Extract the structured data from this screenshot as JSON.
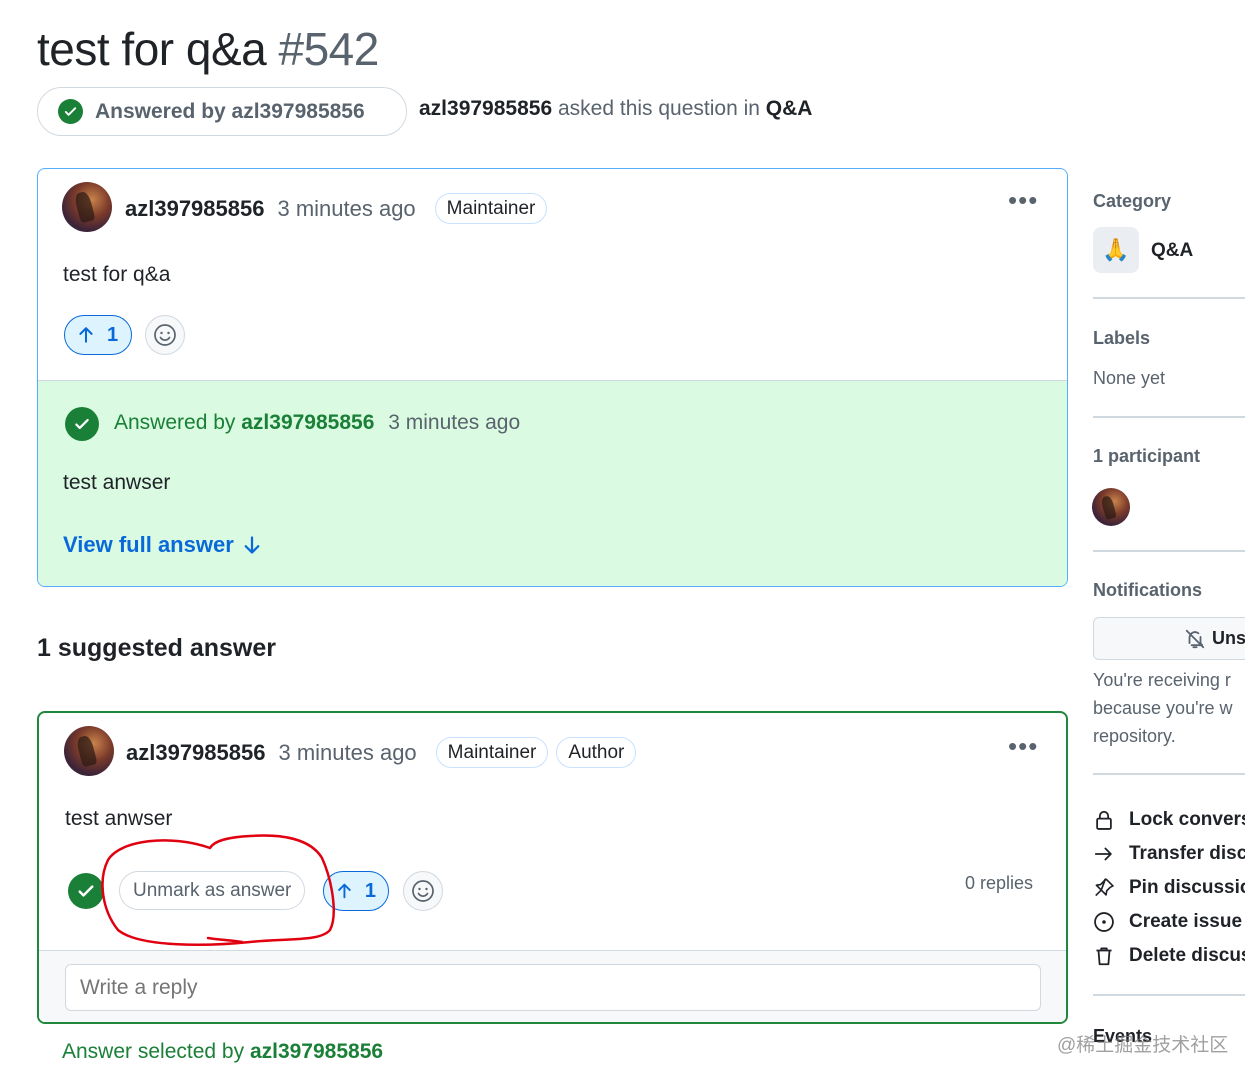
{
  "header": {
    "title": "test for q&a",
    "number": "#542",
    "answered_pill": "Answered by azl397985856",
    "asker": "azl397985856",
    "asked_text": "asked this question in",
    "category": "Q&A"
  },
  "question": {
    "author": "azl397985856",
    "time": "3 minutes ago",
    "badge": "Maintainer",
    "menu": "•••",
    "body": "test for q&a",
    "upvotes": "1",
    "answered_prefix": "Answered by",
    "answered_user": "azl397985856",
    "answered_time": "3 minutes ago",
    "answer_preview": "test anwser",
    "view_full": "View full answer"
  },
  "suggested_heading": "1 suggested answer",
  "answer": {
    "author": "azl397985856",
    "time": "3 minutes ago",
    "badges": [
      "Maintainer",
      "Author"
    ],
    "menu": "•••",
    "body": "test anwser",
    "unmark_label": "Unmark as answer",
    "upvotes": "1",
    "replies": "0 replies",
    "reply_placeholder": "Write a reply"
  },
  "selected_line": {
    "prefix": "Answer selected by",
    "user": "azl397985856"
  },
  "sidebar": {
    "category_heading": "Category",
    "category_emoji": "🙏",
    "category_name": "Q&A",
    "labels_heading": "Labels",
    "labels_value": "None yet",
    "participants_heading": "1 participant",
    "notifications_heading": "Notifications",
    "unsubscribe_label": "Uns",
    "notify_lines": [
      "You're receiving r",
      "because you're w",
      "repository."
    ],
    "actions": [
      {
        "label": "Lock convers",
        "icon": "lock-icon"
      },
      {
        "label": "Transfer disc",
        "icon": "arrow-right-icon"
      },
      {
        "label": "Pin discussio",
        "icon": "pin-icon"
      },
      {
        "label": "Create issue",
        "icon": "issue-icon"
      },
      {
        "label": "Delete discus",
        "icon": "trash-icon"
      }
    ],
    "events_heading": "Events"
  },
  "watermark": "@稀土掘金技术社区",
  "colors": {
    "accent_blue": "#0969da",
    "success_green": "#1a7f37",
    "answer_bg": "#dafbe1",
    "annotation_red": "#e0000f"
  }
}
